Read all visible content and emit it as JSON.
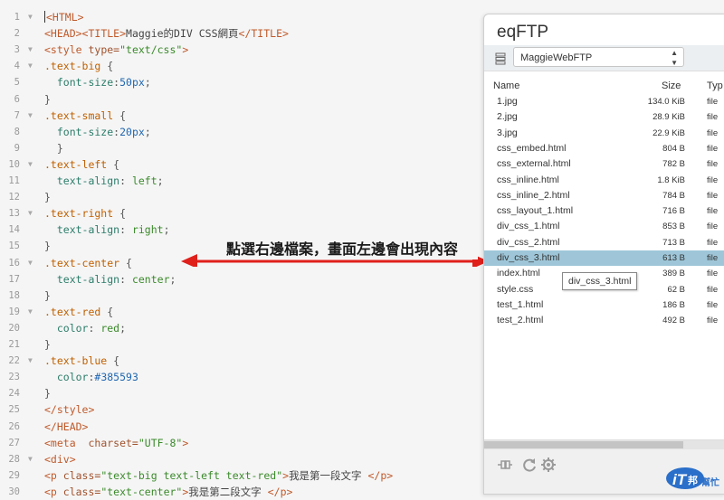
{
  "editor": {
    "lines": [
      {
        "n": "1",
        "fold": true,
        "tokens": [
          [
            "cursor",
            ""
          ],
          [
            "tag",
            "<HTML>"
          ]
        ]
      },
      {
        "n": "2",
        "fold": false,
        "tokens": [
          [
            "tag",
            "<HEAD>"
          ],
          [
            "tag",
            "<TITLE>"
          ],
          [
            "text",
            "Maggie的DIV CSS網頁"
          ],
          [
            "tag",
            "</TITLE>"
          ]
        ]
      },
      {
        "n": "3",
        "fold": true,
        "tokens": [
          [
            "tag",
            "<style "
          ],
          [
            "attr",
            "type="
          ],
          [
            "str",
            "\"text/css\""
          ],
          [
            "tag",
            ">"
          ]
        ]
      },
      {
        "n": "4",
        "fold": true,
        "tokens": [
          [
            "sel",
            ".text-big"
          ],
          [
            "punct",
            " {"
          ]
        ]
      },
      {
        "n": "5",
        "fold": false,
        "tokens": [
          [
            "prop",
            "  font-size"
          ],
          [
            "punct",
            ":"
          ],
          [
            "num",
            "50px"
          ],
          [
            "punct",
            ";"
          ]
        ]
      },
      {
        "n": "6",
        "fold": false,
        "tokens": [
          [
            "punct",
            "}"
          ]
        ]
      },
      {
        "n": "7",
        "fold": true,
        "tokens": [
          [
            "sel",
            ".text-small"
          ],
          [
            "punct",
            " {"
          ]
        ]
      },
      {
        "n": "8",
        "fold": false,
        "tokens": [
          [
            "prop",
            "  font-size"
          ],
          [
            "punct",
            ":"
          ],
          [
            "num",
            "20px"
          ],
          [
            "punct",
            ";"
          ]
        ]
      },
      {
        "n": "9",
        "fold": false,
        "tokens": [
          [
            "punct",
            "  }"
          ]
        ]
      },
      {
        "n": "10",
        "fold": true,
        "tokens": [
          [
            "sel",
            ".text-left"
          ],
          [
            "punct",
            " {"
          ]
        ]
      },
      {
        "n": "11",
        "fold": false,
        "tokens": [
          [
            "prop",
            "  text-align"
          ],
          [
            "punct",
            ": "
          ],
          [
            "str",
            "left"
          ],
          [
            "punct",
            ";"
          ]
        ]
      },
      {
        "n": "12",
        "fold": false,
        "tokens": [
          [
            "punct",
            "}"
          ]
        ]
      },
      {
        "n": "13",
        "fold": true,
        "tokens": [
          [
            "sel",
            ".text-right"
          ],
          [
            "punct",
            " {"
          ]
        ]
      },
      {
        "n": "14",
        "fold": false,
        "tokens": [
          [
            "prop",
            "  text-align"
          ],
          [
            "punct",
            ": "
          ],
          [
            "str",
            "right"
          ],
          [
            "punct",
            ";"
          ]
        ]
      },
      {
        "n": "15",
        "fold": false,
        "tokens": [
          [
            "punct",
            "}"
          ]
        ]
      },
      {
        "n": "16",
        "fold": true,
        "tokens": [
          [
            "sel",
            ".text-center"
          ],
          [
            "punct",
            " {"
          ]
        ]
      },
      {
        "n": "17",
        "fold": false,
        "tokens": [
          [
            "prop",
            "  text-align"
          ],
          [
            "punct",
            ": "
          ],
          [
            "str",
            "center"
          ],
          [
            "punct",
            ";"
          ]
        ]
      },
      {
        "n": "18",
        "fold": false,
        "tokens": [
          [
            "punct",
            "}"
          ]
        ]
      },
      {
        "n": "19",
        "fold": true,
        "tokens": [
          [
            "sel",
            ".text-red"
          ],
          [
            "punct",
            " {"
          ]
        ]
      },
      {
        "n": "20",
        "fold": false,
        "tokens": [
          [
            "prop",
            "  color"
          ],
          [
            "punct",
            ": "
          ],
          [
            "str",
            "red"
          ],
          [
            "punct",
            ";"
          ]
        ]
      },
      {
        "n": "21",
        "fold": false,
        "tokens": [
          [
            "punct",
            "}"
          ]
        ]
      },
      {
        "n": "22",
        "fold": true,
        "tokens": [
          [
            "sel",
            ".text-blue"
          ],
          [
            "punct",
            " {"
          ]
        ]
      },
      {
        "n": "23",
        "fold": false,
        "tokens": [
          [
            "prop",
            "  color"
          ],
          [
            "punct",
            ":"
          ],
          [
            "num",
            "#385593"
          ]
        ]
      },
      {
        "n": "24",
        "fold": false,
        "tokens": [
          [
            "punct",
            "}"
          ]
        ]
      },
      {
        "n": "25",
        "fold": false,
        "tokens": [
          [
            "tag",
            "</style>"
          ]
        ]
      },
      {
        "n": "26",
        "fold": false,
        "tokens": [
          [
            "tag",
            "</HEAD>"
          ]
        ]
      },
      {
        "n": "27",
        "fold": false,
        "tokens": [
          [
            "tag",
            "<meta  "
          ],
          [
            "attr",
            "charset="
          ],
          [
            "str",
            "\"UTF-8\""
          ],
          [
            "tag",
            ">"
          ]
        ]
      },
      {
        "n": "28",
        "fold": true,
        "tokens": [
          [
            "tag",
            "<div>"
          ]
        ]
      },
      {
        "n": "29",
        "fold": false,
        "tokens": [
          [
            "tag",
            "<p "
          ],
          [
            "attr",
            "class="
          ],
          [
            "str",
            "\"text-big text-left text-red\""
          ],
          [
            "tag",
            ">"
          ],
          [
            "text",
            "我是第一段文字 "
          ],
          [
            "tag",
            "</p>"
          ]
        ]
      },
      {
        "n": "30",
        "fold": false,
        "tokens": [
          [
            "tag",
            "<p "
          ],
          [
            "attr",
            "class="
          ],
          [
            "str",
            "\"text-center\""
          ],
          [
            "tag",
            ">"
          ],
          [
            "text",
            "我是第二段文字 "
          ],
          [
            "tag",
            "</p>"
          ]
        ]
      }
    ]
  },
  "annotation": {
    "text": "點選右邊檔案，畫面左邊會出現內容",
    "arrow_color": "#e0201b"
  },
  "ftp": {
    "title": "eqFTP",
    "connection": "MaggieWebFTP",
    "columns": {
      "name": "Name",
      "size": "Size",
      "type": "Typ"
    },
    "files": [
      {
        "name": "1.jpg",
        "size": "134.0 KiB",
        "type": "file"
      },
      {
        "name": "2.jpg",
        "size": "28.9 KiB",
        "type": "file"
      },
      {
        "name": "3.jpg",
        "size": "22.9 KiB",
        "type": "file"
      },
      {
        "name": "css_embed.html",
        "size": "804 B",
        "type": "file"
      },
      {
        "name": "css_external.html",
        "size": "782 B",
        "type": "file"
      },
      {
        "name": "css_inline.html",
        "size": "1.8 KiB",
        "type": "file"
      },
      {
        "name": "css_inline_2.html",
        "size": "784 B",
        "type": "file"
      },
      {
        "name": "css_layout_1.html",
        "size": "716 B",
        "type": "file"
      },
      {
        "name": "div_css_1.html",
        "size": "853 B",
        "type": "file"
      },
      {
        "name": "div_css_2.html",
        "size": "713 B",
        "type": "file"
      },
      {
        "name": "div_css_3.html",
        "size": "613 B",
        "type": "file",
        "selected": true
      },
      {
        "name": "index.html",
        "size": "389 B",
        "type": "file"
      },
      {
        "name": "style.css",
        "size": "62 B",
        "type": "file"
      },
      {
        "name": "test_1.html",
        "size": "186 B",
        "type": "file"
      },
      {
        "name": "test_2.html",
        "size": "492 B",
        "type": "file"
      }
    ],
    "tooltip": "div_css_3.html",
    "selection_color": "#9ec6d8"
  },
  "watermark": {
    "main": "iT",
    "sub": "邦",
    "tag": "幫忙",
    "color": "#2a6fc9"
  }
}
